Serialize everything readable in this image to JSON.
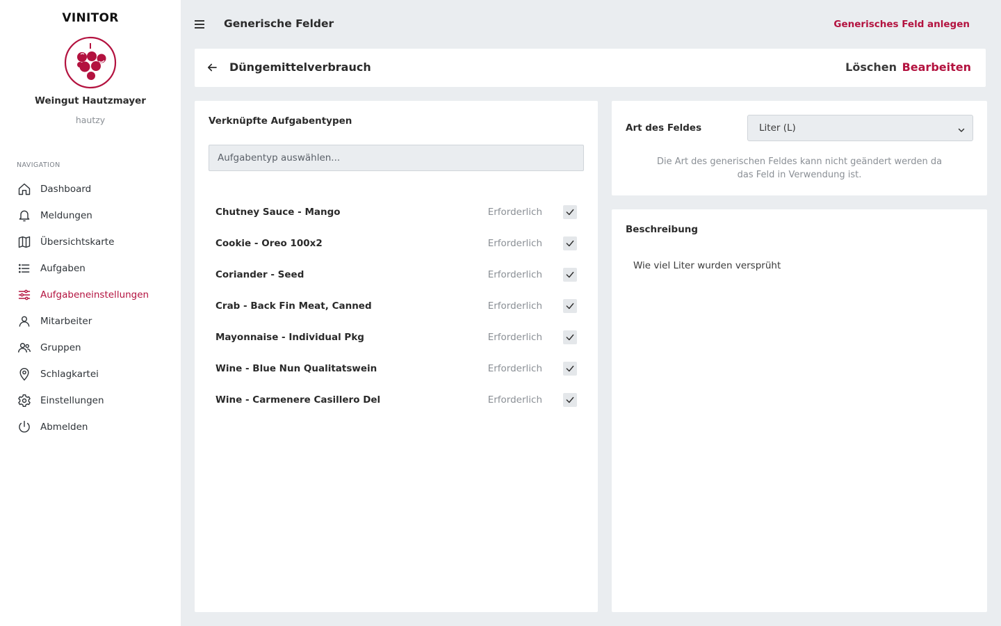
{
  "sidebar": {
    "brand": "VINITOR",
    "org_name": "Weingut Hautzmayer",
    "org_user": "hautzy",
    "nav_heading": "NAVIGATION",
    "items": [
      {
        "label": "Dashboard",
        "icon": "home-icon",
        "active": false
      },
      {
        "label": "Meldungen",
        "icon": "bell-icon",
        "active": false
      },
      {
        "label": "Übersichtskarte",
        "icon": "map-icon",
        "active": false
      },
      {
        "label": "Aufgaben",
        "icon": "list-icon",
        "active": false
      },
      {
        "label": "Aufgabeneinstellungen",
        "icon": "sliders-icon",
        "active": true
      },
      {
        "label": "Mitarbeiter",
        "icon": "user-icon",
        "active": false
      },
      {
        "label": "Gruppen",
        "icon": "users-icon",
        "active": false
      },
      {
        "label": "Schlagkartei",
        "icon": "map-pin-icon",
        "active": false
      },
      {
        "label": "Einstellungen",
        "icon": "gear-icon",
        "active": false
      },
      {
        "label": "Abmelden",
        "icon": "power-icon",
        "active": false
      }
    ]
  },
  "header": {
    "title": "Generische Felder",
    "action_label": "Generisches Feld anlegen"
  },
  "detail": {
    "title": "Düngemittelverbrauch",
    "delete_label": "Löschen",
    "edit_label": "Bearbeiten"
  },
  "linked_tasks": {
    "heading": "Verknüpfte Aufgabentypen",
    "select_placeholder": "Aufgabentyp auswählen...",
    "required_label": "Erforderlich",
    "items": [
      {
        "name": "Chutney Sauce - Mango",
        "required": true
      },
      {
        "name": "Cookie - Oreo 100x2",
        "required": true
      },
      {
        "name": "Coriander - Seed",
        "required": true
      },
      {
        "name": "Crab - Back Fin Meat, Canned",
        "required": true
      },
      {
        "name": "Mayonnaise - Individual Pkg",
        "required": true
      },
      {
        "name": "Wine - Blue Nun Qualitatswein",
        "required": true
      },
      {
        "name": "Wine - Carmenere Casillero Del",
        "required": true
      }
    ]
  },
  "field_type": {
    "label": "Art des Feldes",
    "selected": "Liter (L)",
    "note": "Die Art des generischen Feldes kann nicht geändert werden da das Feld in Verwendung ist."
  },
  "description": {
    "heading": "Beschreibung",
    "text": "Wie viel Liter wurden versprüht"
  },
  "colors": {
    "accent": "#b3123f",
    "background": "#eaedf0",
    "card": "#ffffff",
    "muted": "#8a8f95"
  }
}
